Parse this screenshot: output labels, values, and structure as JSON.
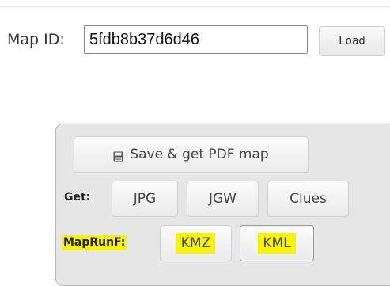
{
  "map_id": {
    "label": "Map ID:",
    "value": "5fdb8b37d6d46",
    "load_label": "Load"
  },
  "export": {
    "save_pdf_label": "Save & get PDF map",
    "save_icon": "floppy-disk-icon",
    "get_label": "Get:",
    "get_buttons": {
      "jpg": "JPG",
      "jgw": "JGW",
      "clues": "Clues"
    },
    "maprunf_label": "MapRunF:",
    "maprunf_buttons": {
      "kmz": "KMZ",
      "kml": "KML"
    },
    "highlight_color": "#f8f400"
  }
}
